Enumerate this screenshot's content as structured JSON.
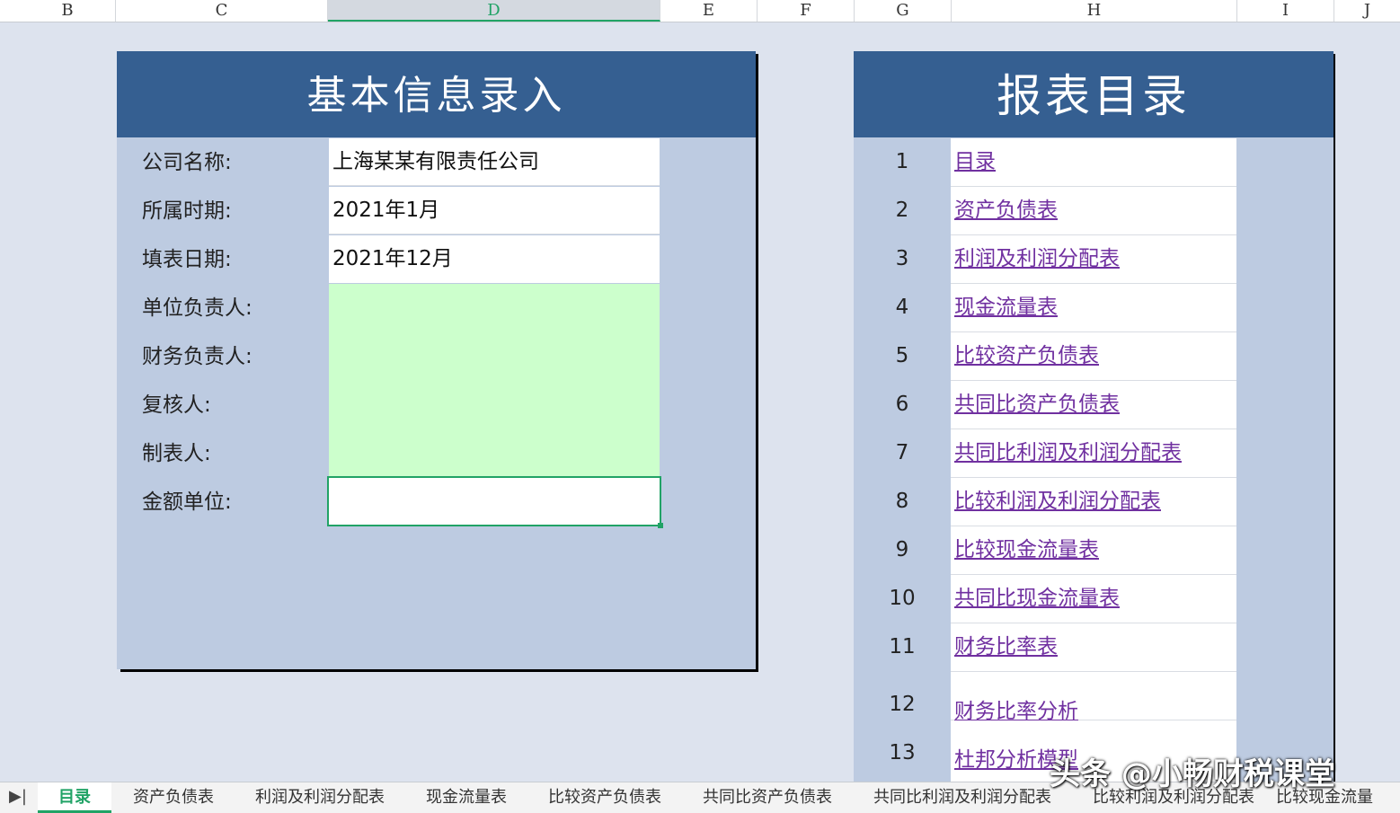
{
  "columns": [
    "B",
    "C",
    "D",
    "E",
    "F",
    "G",
    "H",
    "I",
    "J"
  ],
  "info_panel": {
    "title": "基本信息录入",
    "fields": [
      {
        "label": "公司名称:",
        "value": "上海某某有限责任公司"
      },
      {
        "label": "所属时期:",
        "value": "2021年1月"
      },
      {
        "label": "填表日期:",
        "value": "2021年12月"
      },
      {
        "label": "单位负责人:",
        "value": ""
      },
      {
        "label": "财务负责人:",
        "value": ""
      },
      {
        "label": "复核人:",
        "value": ""
      },
      {
        "label": "制表人:",
        "value": ""
      },
      {
        "label": "金额单位:",
        "value": ""
      }
    ]
  },
  "catalog_panel": {
    "title": "报表目录",
    "items": [
      {
        "num": "1",
        "label": "目录"
      },
      {
        "num": "2",
        "label": "资产负债表"
      },
      {
        "num": "3",
        "label": "利润及利润分配表"
      },
      {
        "num": "4",
        "label": "现金流量表"
      },
      {
        "num": "5",
        "label": "比较资产负债表"
      },
      {
        "num": "6",
        "label": "共同比资产负债表"
      },
      {
        "num": "7",
        "label": "共同比利润及利润分配表"
      },
      {
        "num": "8",
        "label": "比较利润及利润分配表"
      },
      {
        "num": "9",
        "label": "比较现金流量表"
      },
      {
        "num": "10",
        "label": "共同比现金流量表"
      },
      {
        "num": "11",
        "label": "财务比率表"
      },
      {
        "num": "12",
        "label": "财务比率分析"
      },
      {
        "num": "13",
        "label": "杜邦分析模型"
      }
    ]
  },
  "sheet_tabs": [
    "目录",
    "资产负债表",
    "利润及利润分配表",
    "现金流量表",
    "比较资产负债表",
    "共同比资产负债表",
    "共同比利润及利润分配表",
    "比较利润及利润分配表",
    "比较现金流量"
  ],
  "active_tab": "目录",
  "watermark": "头条 @小畅财税课堂",
  "colors": {
    "header_blue": "#355f91",
    "panel_bg": "#bdcbe1",
    "link": "#7030a0",
    "accent_green": "#21a366",
    "input_green": "#ccffcc"
  }
}
